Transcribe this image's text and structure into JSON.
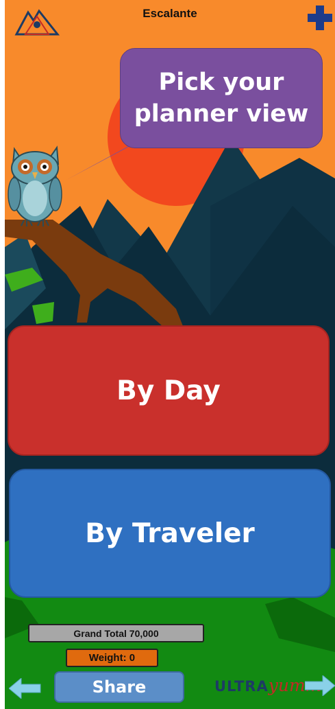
{
  "header": {
    "title": "Escalante",
    "logo_icon": "mountain-logo-icon",
    "add_icon": "plus-icon"
  },
  "speech_bubble": {
    "text": "Pick your planner view"
  },
  "mascot": {
    "icon": "owl-icon"
  },
  "buttons": {
    "by_day": "By Day",
    "by_traveler": "By Traveler"
  },
  "footer": {
    "grand_total": "Grand Total 70,000",
    "weight": "Weight: 0",
    "share": "Share",
    "back_icon": "arrow-left-icon",
    "next_icon": "arrow-right-icon",
    "brand_ultra": "ULTRA",
    "brand_yumm": "yumm"
  },
  "colors": {
    "sky": "#f88a2b",
    "sun": "#f2481e",
    "mountains": "#0c2c3c",
    "grass": "#128a12",
    "by_day": "#c9302c",
    "by_traveler": "#2f70c1",
    "bubble": "#7a4f9e"
  }
}
